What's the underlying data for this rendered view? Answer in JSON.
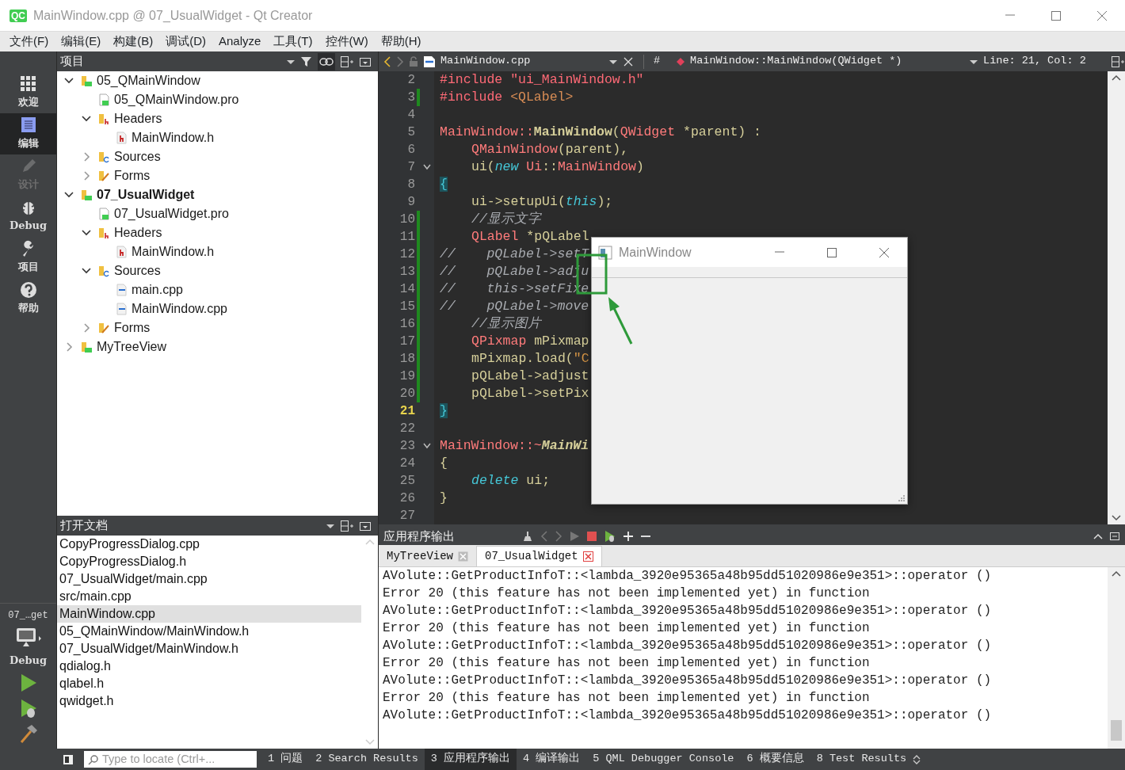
{
  "window": {
    "logo": "QC",
    "title": "MainWindow.cpp @ 07_UsualWidget - Qt Creator"
  },
  "menu": [
    "文件(F)",
    "编辑(E)",
    "构建(B)",
    "调试(D)",
    "Analyze",
    "工具(T)",
    "控件(W)",
    "帮助(H)"
  ],
  "mode_bar": [
    {
      "label": "欢迎",
      "kind": "welcome",
      "selected": false,
      "disabled": false
    },
    {
      "label": "编辑",
      "kind": "edit",
      "selected": true,
      "disabled": false
    },
    {
      "label": "设计",
      "kind": "design",
      "selected": false,
      "disabled": true
    },
    {
      "label": "Debug",
      "kind": "debug",
      "selected": false,
      "disabled": false
    },
    {
      "label": "项目",
      "kind": "projects",
      "selected": false,
      "disabled": false
    },
    {
      "label": "帮助",
      "kind": "help",
      "selected": false,
      "disabled": false
    }
  ],
  "kit_selector": {
    "project": "07_…get",
    "build": "Debug"
  },
  "project_pane": {
    "title": "项目",
    "tree": [
      {
        "label": "05_QMainWindow",
        "kind": "project",
        "expanded": true,
        "active": false,
        "children": [
          {
            "label": "05_QMainWindow.pro",
            "kind": "pro"
          },
          {
            "label": "Headers",
            "kind": "headers",
            "expanded": true,
            "children": [
              {
                "label": "MainWindow.h",
                "kind": "header"
              }
            ]
          },
          {
            "label": "Sources",
            "kind": "sources",
            "expanded": false
          },
          {
            "label": "Forms",
            "kind": "forms",
            "expanded": false
          }
        ]
      },
      {
        "label": "07_UsualWidget",
        "kind": "project",
        "expanded": true,
        "active": true,
        "children": [
          {
            "label": "07_UsualWidget.pro",
            "kind": "pro"
          },
          {
            "label": "Headers",
            "kind": "headers",
            "expanded": true,
            "children": [
              {
                "label": "MainWindow.h",
                "kind": "header"
              }
            ]
          },
          {
            "label": "Sources",
            "kind": "sources",
            "expanded": true,
            "children": [
              {
                "label": "main.cpp",
                "kind": "source"
              },
              {
                "label": "MainWindow.cpp",
                "kind": "source"
              }
            ]
          },
          {
            "label": "Forms",
            "kind": "forms",
            "expanded": false
          }
        ]
      },
      {
        "label": "MyTreeView",
        "kind": "project",
        "expanded": false,
        "active": false
      }
    ]
  },
  "open_documents": {
    "title": "打开文档",
    "items": [
      {
        "label": "CopyProgressDialog.cpp",
        "selected": false
      },
      {
        "label": "CopyProgressDialog.h",
        "selected": false
      },
      {
        "label": "07_UsualWidget/main.cpp",
        "selected": false
      },
      {
        "label": "src/main.cpp",
        "selected": false
      },
      {
        "label": "MainWindow.cpp",
        "selected": true
      },
      {
        "label": "05_QMainWindow/MainWindow.h",
        "selected": false
      },
      {
        "label": "07_UsualWidget/MainWindow.h",
        "selected": false
      },
      {
        "label": "qdialog.h",
        "selected": false
      },
      {
        "label": "qlabel.h",
        "selected": false
      },
      {
        "label": "qwidget.h",
        "selected": false
      }
    ]
  },
  "editor": {
    "file": "MainWindow.cpp",
    "symbol_marker": "#",
    "symbol": "MainWindow::MainWindow(QWidget *)",
    "position": "Line: 21, Col: 2",
    "lines": [
      {
        "number": "2",
        "tokens": [
          {
            "text": "#include ",
            "kind": "pp"
          },
          {
            "text": "\"ui_MainWindow.h\"",
            "kind": "pp"
          }
        ],
        "modified": false,
        "fold": false,
        "current": false,
        "indented": false
      },
      {
        "number": "3",
        "tokens": [
          {
            "text": "#include ",
            "kind": "pp"
          },
          {
            "text": "<QLabel>",
            "kind": "inc"
          }
        ],
        "modified": true,
        "fold": false,
        "current": false,
        "indented": false
      },
      {
        "number": "4",
        "modified": false,
        "fold": false,
        "current": false
      },
      {
        "number": "5",
        "tokens": [
          {
            "text": "MainWindow::",
            "kind": "type"
          },
          {
            "text": "MainWindow",
            "kind": "fn"
          },
          {
            "text": "(",
            "kind": "plain"
          },
          {
            "text": "QWidget",
            "kind": "type"
          },
          {
            "text": " *parent) :",
            "kind": "plain"
          }
        ],
        "modified": false,
        "fold": false,
        "current": false,
        "indented": false
      },
      {
        "number": "6",
        "tokens": [
          {
            "text": "QMainWindow",
            "kind": "type"
          },
          {
            "text": "(parent),",
            "kind": "plain"
          }
        ],
        "modified": false,
        "fold": false,
        "current": false,
        "indented": true
      },
      {
        "number": "7",
        "tokens": [
          {
            "text": "ui(",
            "kind": "plain"
          },
          {
            "text": "new ",
            "kind": "kw"
          },
          {
            "text": "Ui",
            "kind": "type"
          },
          {
            "text": "::",
            "kind": "plain"
          },
          {
            "text": "MainWindow",
            "kind": "type"
          },
          {
            "text": ")",
            "kind": "plain"
          }
        ],
        "modified": false,
        "fold": true,
        "current": false,
        "indented": true
      },
      {
        "number": "8",
        "tokens": [
          {
            "text": "{",
            "kind": "brace"
          }
        ],
        "modified": false,
        "fold": false,
        "current": false,
        "indented": false
      },
      {
        "number": "9",
        "tokens": [
          {
            "text": "ui->setupUi(",
            "kind": "plain"
          },
          {
            "text": "this",
            "kind": "kw"
          },
          {
            "text": ");",
            "kind": "plain"
          }
        ],
        "modified": false,
        "fold": false,
        "current": false,
        "indented": true
      },
      {
        "number": "10",
        "tokens": [
          {
            "text": "//显示文字",
            "kind": "cm"
          }
        ],
        "modified": true,
        "fold": false,
        "current": false,
        "indented": true
      },
      {
        "number": "11",
        "tokens": [
          {
            "text": "QLabel",
            "kind": "type"
          },
          {
            "text": " *pQLabel",
            "kind": "plain"
          }
        ],
        "modified": true,
        "fold": false,
        "current": false,
        "indented": true
      },
      {
        "number": "12",
        "tokens": [
          {
            "text": "//    pQLabel->setT",
            "kind": "cm"
          }
        ],
        "modified": true,
        "fold": false,
        "current": false,
        "indented": false
      },
      {
        "number": "13",
        "tokens": [
          {
            "text": "//    pQLabel->adju",
            "kind": "cm"
          }
        ],
        "modified": true,
        "fold": false,
        "current": false,
        "indented": false
      },
      {
        "number": "14",
        "tokens": [
          {
            "text": "//    this->setFixe",
            "kind": "cm"
          }
        ],
        "modified": true,
        "fold": false,
        "current": false,
        "indented": false
      },
      {
        "number": "15",
        "tokens": [
          {
            "text": "//    pQLabel->move",
            "kind": "cm"
          }
        ],
        "modified": true,
        "fold": false,
        "current": false,
        "indented": false
      },
      {
        "number": "16",
        "tokens": [
          {
            "text": "//显示图片",
            "kind": "cm"
          }
        ],
        "modified": true,
        "fold": false,
        "current": false,
        "indented": true
      },
      {
        "number": "17",
        "tokens": [
          {
            "text": "QPixmap",
            "kind": "type"
          },
          {
            "text": " mPixmap",
            "kind": "plain"
          }
        ],
        "modified": true,
        "fold": false,
        "current": false,
        "indented": true
      },
      {
        "number": "18",
        "tokens": [
          {
            "text": "mPixmap.load(",
            "kind": "plain"
          },
          {
            "text": "\"C",
            "kind": "str"
          }
        ],
        "modified": true,
        "fold": false,
        "current": false,
        "indented": true
      },
      {
        "number": "19",
        "tokens": [
          {
            "text": "pQLabel->adjust",
            "kind": "plain"
          }
        ],
        "modified": true,
        "fold": false,
        "current": false,
        "indented": true
      },
      {
        "number": "20",
        "tokens": [
          {
            "text": "pQLabel->setPix",
            "kind": "plain"
          }
        ],
        "modified": true,
        "fold": false,
        "current": false,
        "indented": true
      },
      {
        "number": "21",
        "tokens": [
          {
            "text": "}",
            "kind": "brace"
          }
        ],
        "modified": false,
        "fold": false,
        "current": true,
        "indented": false
      },
      {
        "number": "22",
        "modified": false,
        "fold": false,
        "current": false
      },
      {
        "number": "23",
        "tokens": [
          {
            "text": "MainWindow::~",
            "kind": "type"
          },
          {
            "text": "MainWi",
            "kind": "dtor"
          }
        ],
        "modified": false,
        "fold": true,
        "current": false,
        "indented": false
      },
      {
        "number": "24",
        "tokens": [
          {
            "text": "{",
            "kind": "plain"
          }
        ],
        "modified": false,
        "fold": false,
        "current": false,
        "indented": false
      },
      {
        "number": "25",
        "tokens": [
          {
            "text": "delete",
            "kind": "kw"
          },
          {
            "text": " ui;",
            "kind": "plain"
          }
        ],
        "modified": false,
        "fold": false,
        "current": false,
        "indented": true
      },
      {
        "number": "26",
        "tokens": [
          {
            "text": "}",
            "kind": "plain"
          }
        ],
        "modified": false,
        "fold": false,
        "current": false,
        "indented": false
      },
      {
        "number": "27",
        "modified": false,
        "fold": false,
        "current": false
      }
    ]
  },
  "app_window": {
    "title": "MainWindow"
  },
  "output_pane": {
    "title": "应用程序输出",
    "tabs": [
      {
        "label": "MyTreeView",
        "selected": false
      },
      {
        "label": "07_UsualWidget",
        "selected": true
      }
    ],
    "lines": [
      "AVolute::GetProductInfoT::<lambda_3920e95365a48b95dd51020986e9e351>::operator ()",
      "Error 20 (this feature has not been implemented yet) in function",
      "AVolute::GetProductInfoT::<lambda_3920e95365a48b95dd51020986e9e351>::operator ()",
      "Error 20 (this feature has not been implemented yet) in function",
      "AVolute::GetProductInfoT::<lambda_3920e95365a48b95dd51020986e9e351>::operator ()",
      "Error 20 (this feature has not been implemented yet) in function",
      "AVolute::GetProductInfoT::<lambda_3920e95365a48b95dd51020986e9e351>::operator ()",
      "Error 20 (this feature has not been implemented yet) in function",
      "AVolute::GetProductInfoT::<lambda_3920e95365a48b95dd51020986e9e351>::operator ()"
    ]
  },
  "locator": {
    "placeholder": "Type to locate (Ctrl+..."
  },
  "status_tabs": [
    {
      "number": "1",
      "label": "问题",
      "selected": false
    },
    {
      "number": "2",
      "label": "Search Results",
      "selected": false
    },
    {
      "number": "3",
      "label": "应用程序输出",
      "selected": true
    },
    {
      "number": "4",
      "label": "编译输出",
      "selected": false
    },
    {
      "number": "5",
      "label": "QML Debugger Console",
      "selected": false
    },
    {
      "number": "6",
      "label": "概要信息",
      "selected": false
    },
    {
      "number": "8",
      "label": "Test Results",
      "selected": false
    }
  ]
}
